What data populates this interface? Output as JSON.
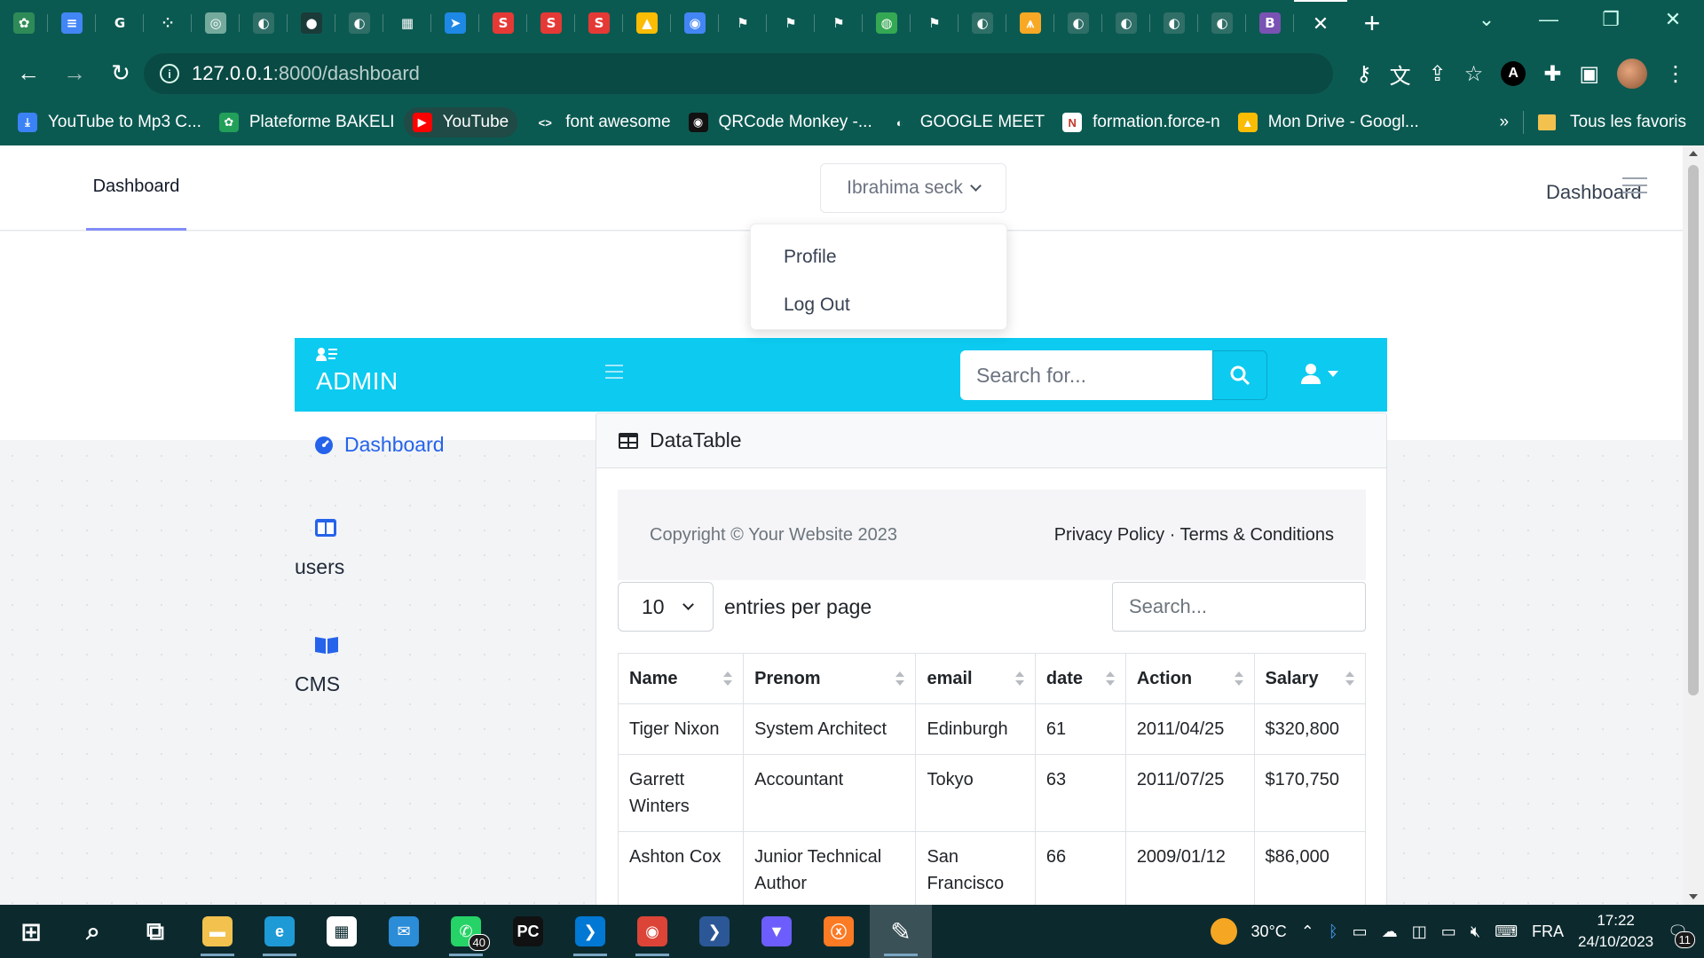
{
  "browser": {
    "url_host": "127.0.0.1",
    "url_path": ":8000/dashboard",
    "tabs": [
      {
        "icon": "leaf-favicon-icon",
        "color": "#2e8b57",
        "glyph": "✿"
      },
      {
        "icon": "docs-favicon-icon",
        "color": "#4285f4",
        "glyph": "≡"
      },
      {
        "icon": "google-favicon-icon",
        "color": "#ffffff",
        "glyph": "G"
      },
      {
        "icon": "dots-favicon-icon",
        "color": "#0b5a52",
        "glyph": "⁘"
      },
      {
        "icon": "chatgpt-favicon-icon",
        "color": "#74aa9c",
        "glyph": "◎"
      },
      {
        "icon": "globe-favicon-icon",
        "color": "#2f6f68",
        "glyph": "◐"
      },
      {
        "icon": "github-favicon-icon",
        "color": "#1b3b39",
        "glyph": "●"
      },
      {
        "icon": "globe-favicon-icon",
        "color": "#2f6f68",
        "glyph": "◐"
      },
      {
        "icon": "grid-favicon-icon",
        "color": "#ffffff",
        "glyph": "▦"
      },
      {
        "icon": "send-favicon-icon",
        "color": "#1e88e5",
        "glyph": "➤"
      },
      {
        "icon": "s-favicon-icon",
        "color": "#e53935",
        "glyph": "S"
      },
      {
        "icon": "s-favicon-icon",
        "color": "#e53935",
        "glyph": "S"
      },
      {
        "icon": "s-favicon-icon",
        "color": "#e53935",
        "glyph": "S"
      },
      {
        "icon": "drive-favicon-icon",
        "color": "#fbbc04",
        "glyph": "▲"
      },
      {
        "icon": "meet-favicon-icon",
        "color": "#4285f4",
        "glyph": "◉"
      },
      {
        "icon": "flag-favicon-icon",
        "color": "#ffffff",
        "glyph": "⚑"
      },
      {
        "icon": "flag-favicon-icon",
        "color": "#ffffff",
        "glyph": "⚑"
      },
      {
        "icon": "flag-favicon-icon",
        "color": "#ffffff",
        "glyph": "⚑"
      },
      {
        "icon": "earth-favicon-icon",
        "color": "#34a853",
        "glyph": "◍"
      },
      {
        "icon": "flag-favicon-icon",
        "color": "#ffffff",
        "glyph": "⚑"
      },
      {
        "icon": "globe-favicon-icon",
        "color": "#2f6f68",
        "glyph": "◐"
      },
      {
        "icon": "laravel-favicon-icon",
        "color": "#f9a825",
        "glyph": "⩚"
      },
      {
        "icon": "globe-favicon-icon",
        "color": "#2f6f68",
        "glyph": "◐"
      },
      {
        "icon": "globe-favicon-icon",
        "color": "#2f6f68",
        "glyph": "◐"
      },
      {
        "icon": "globe-favicon-icon",
        "color": "#2f6f68",
        "glyph": "◐"
      },
      {
        "icon": "globe-favicon-icon",
        "color": "#2f6f68",
        "glyph": "◐"
      },
      {
        "icon": "bootstrap-favicon-icon",
        "color": "#7952b3",
        "glyph": "B"
      }
    ],
    "active_tab_close": "✕",
    "new_tab": "+",
    "bookmarks": [
      {
        "label": "YouTube to Mp3 C...",
        "icon": "download-icon",
        "color": "#3b82f6",
        "glyph": "⤓"
      },
      {
        "label": "Plateforme BAKELI",
        "icon": "bakeli-icon",
        "color": "#22a05a",
        "glyph": "✿"
      },
      {
        "label": "YouTube",
        "icon": "youtube-icon",
        "color": "#ff0000",
        "glyph": "▶"
      },
      {
        "label": "font awesome",
        "icon": "code-icon",
        "color": "#0b5a52",
        "glyph": "<>"
      },
      {
        "label": "QRCode Monkey -...",
        "icon": "monkey-icon",
        "color": "#111111",
        "glyph": "◉"
      },
      {
        "label": "GOOGLE MEET",
        "icon": "globe-icon",
        "color": "#0b5a52",
        "glyph": "◐"
      },
      {
        "label": "formation.force-n",
        "icon": "forcen-icon",
        "color": "#ffffff",
        "glyph": "N"
      },
      {
        "label": "Mon Drive - Googl...",
        "icon": "drive-icon",
        "color": "#fbbc04",
        "glyph": "▲"
      }
    ],
    "more_bookmarks": "»",
    "all_bookmarks": "Tous les favoris"
  },
  "app": {
    "nav_dashboard": "Dashboard",
    "user_name": "Ibrahima seck",
    "header_title": "Dashboard",
    "dropdown": [
      "Profile",
      "Log Out"
    ],
    "admin_title": "ADMIN",
    "search_placeholder": "Search for...",
    "sidebar": {
      "dashboard": "Dashboard",
      "users": "users",
      "cms": "CMS"
    },
    "card_title": "DataTable",
    "copyright": "Copyright © Your Website 2023",
    "footer_links": "Privacy Policy · Terms & Conditions",
    "per_page_value": "10",
    "per_page_label": "entries per page",
    "table_search_placeholder": "Search...",
    "columns": [
      "Name",
      "Prenom",
      "email",
      "date",
      "Action",
      "Salary"
    ],
    "rows": [
      [
        "Tiger Nixon",
        "System Architect",
        "Edinburgh",
        "61",
        "2011/04/25",
        "$320,800"
      ],
      [
        "Garrett Winters",
        "Accountant",
        "Tokyo",
        "63",
        "2011/07/25",
        "$170,750"
      ],
      [
        "Ashton Cox",
        "Junior Technical Author",
        "San Francisco",
        "66",
        "2009/01/12",
        "$86,000"
      ]
    ],
    "colors": {
      "accent": "#0dcaf0",
      "link": "#2563eb",
      "underline": "#818cf8"
    }
  },
  "taskbar": {
    "apps": [
      {
        "icon": "windows-start-icon",
        "color": "#ffffff",
        "glyph": "⊞"
      },
      {
        "icon": "search-icon",
        "color": "#ffffff",
        "glyph": "⌕"
      },
      {
        "icon": "task-view-icon",
        "color": "#ffffff",
        "glyph": "⧉"
      },
      {
        "icon": "file-explorer-icon",
        "color": "#f2c14e",
        "glyph": "▬"
      },
      {
        "icon": "edge-icon",
        "color": "#1e9ad6",
        "glyph": "e"
      },
      {
        "icon": "store-icon",
        "color": "#ffffff",
        "glyph": "▦"
      },
      {
        "icon": "mail-icon",
        "color": "#2b8cd8",
        "glyph": "✉"
      },
      {
        "icon": "whatsapp-icon",
        "color": "#25d366",
        "glyph": "✆"
      },
      {
        "icon": "pycharm-icon",
        "color": "#111111",
        "glyph": "PC"
      },
      {
        "icon": "vscode-icon",
        "color": "#0078d4",
        "glyph": "❯"
      },
      {
        "icon": "chrome-icon",
        "color": "#db4437",
        "glyph": "◉"
      },
      {
        "icon": "powershell-icon",
        "color": "#2b5797",
        "glyph": "❯"
      },
      {
        "icon": "vpn-icon",
        "color": "#6d5dfc",
        "glyph": "▼"
      },
      {
        "icon": "xampp-icon",
        "color": "#fb7a24",
        "glyph": "ⓧ"
      },
      {
        "icon": "paint-icon",
        "color": "#3a5157",
        "glyph": "✎"
      }
    ],
    "whatsapp_badge": "40",
    "temperature": "30°C",
    "language": "FRA",
    "time": "17:22",
    "date": "24/10/2023",
    "notifications": "11"
  }
}
